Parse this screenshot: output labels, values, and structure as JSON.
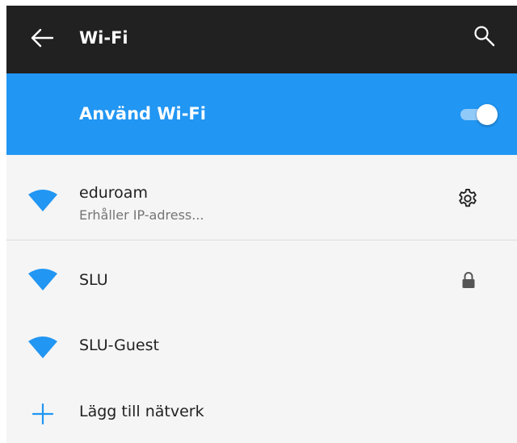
{
  "appbar": {
    "title": "Wi-Fi",
    "back_icon": "arrow-left-icon",
    "search_icon": "search-icon",
    "background": "#212121"
  },
  "master_switch": {
    "label": "Använd Wi-Fi",
    "state": "on",
    "background": "#2196f3"
  },
  "networks": [
    {
      "ssid": "eduroam",
      "status": "Erhåller IP-adress...",
      "icon": "wifi-signal-icon",
      "action_icon": "gear-icon"
    },
    {
      "ssid": "SLU",
      "icon": "wifi-signal-icon",
      "secured_icon": "lock-icon"
    },
    {
      "ssid": "SLU-Guest",
      "icon": "wifi-signal-icon"
    }
  ],
  "add_network": {
    "label": "Lägg till nätverk",
    "icon": "plus-icon"
  },
  "colors": {
    "accent": "#2196f3",
    "list_background": "#f5f5f5",
    "primary_text": "#212121",
    "secondary_text": "#757575"
  }
}
